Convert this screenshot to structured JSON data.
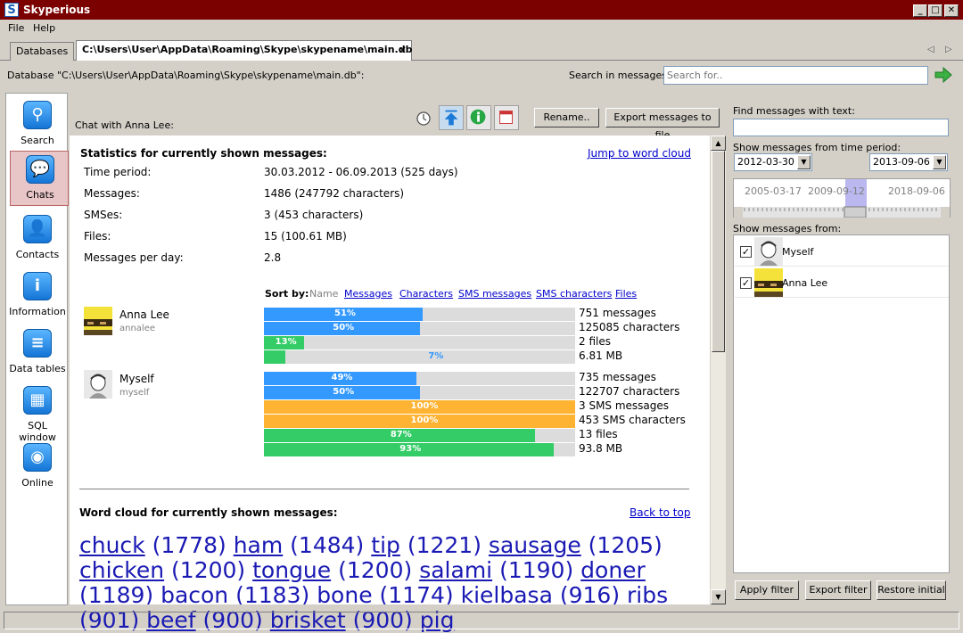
{
  "window": {
    "title": "Skyperious",
    "logo": "S",
    "minimize": "_",
    "maximize": "□",
    "close": "✕"
  },
  "menu": {
    "file": "File",
    "help": "Help"
  },
  "tabs": [
    {
      "label": "Databases"
    },
    {
      "label": "C:\\Users\\User\\AppData\\Roaming\\Skype\\skypename\\main.db",
      "close": "✕"
    }
  ],
  "tab_nav": {
    "prev": "◁",
    "next": "▷"
  },
  "db_path": "Database \"C:\\Users\\User\\AppData\\Roaming\\Skype\\skypename\\main.db\":",
  "search": {
    "label": "Search in messages:",
    "placeholder": "Search for.."
  },
  "nav": [
    {
      "label": "Search",
      "icon": "magnifier-icon"
    },
    {
      "label": "Chats",
      "icon": "chat-bubble-icon"
    },
    {
      "label": "Contacts",
      "icon": "person-icon"
    },
    {
      "label": "Information",
      "icon": "info-icon"
    },
    {
      "label": "Data tables",
      "icon": "database-icon"
    },
    {
      "label": "SQL window",
      "icon": "grid-icon"
    },
    {
      "label": "Online",
      "icon": "signal-icon"
    }
  ],
  "chat": {
    "title": "Chat with Anna Lee:",
    "rename": "Rename..",
    "export": "Export messages to file"
  },
  "stats": {
    "heading": "Statistics for currently shown messages:",
    "jump": "Jump to word cloud",
    "rows": [
      {
        "label": "Time period:",
        "value": "30.03.2012 - 06.09.2013 (525 days)"
      },
      {
        "label": "Messages:",
        "value": "1486 (247792 characters)"
      },
      {
        "label": "SMSes:",
        "value": "3 (453 characters)"
      },
      {
        "label": "Files:",
        "value": "15 (100.61 MB)"
      },
      {
        "label": "Messages per day:",
        "value": "2.8"
      }
    ],
    "sort_label": "Sort by:",
    "sort_options": [
      "Name",
      "Messages",
      "Characters",
      "SMS messages",
      "SMS characters",
      "Files"
    ]
  },
  "participants": [
    {
      "name": "Anna Lee",
      "handle": "annalee",
      "bars": [
        {
          "pct": 51,
          "label": "51%",
          "color": "#3399ff",
          "value": "751 messages"
        },
        {
          "pct": 50,
          "label": "50%",
          "color": "#3399ff",
          "value": "125085 characters"
        },
        {
          "pct": 13,
          "label": "13%",
          "color": "#33cc66",
          "value": "2 files"
        },
        {
          "pct": 7,
          "label": "7%",
          "color": "#33cc66",
          "value": "6.81 MB"
        }
      ]
    },
    {
      "name": "Myself",
      "handle": "myself",
      "bars": [
        {
          "pct": 49,
          "label": "49%",
          "color": "#3399ff",
          "value": "735 messages"
        },
        {
          "pct": 50,
          "label": "50%",
          "color": "#3399ff",
          "value": "122707 characters"
        },
        {
          "pct": 100,
          "label": "100%",
          "color": "#ffb333",
          "value": "3 SMS messages"
        },
        {
          "pct": 100,
          "label": "100%",
          "color": "#ffb333",
          "value": "453 SMS characters"
        },
        {
          "pct": 87,
          "label": "87%",
          "color": "#33cc66",
          "value": "13 files"
        },
        {
          "pct": 93,
          "label": "93%",
          "color": "#33cc66",
          "value": "93.8 MB"
        }
      ]
    }
  ],
  "wordcloud": {
    "heading": "Word cloud for currently shown messages:",
    "back": "Back to top",
    "words": [
      {
        "w": "chuck",
        "n": "(1778)"
      },
      {
        "w": "ham",
        "n": "(1484)"
      },
      {
        "w": "tip",
        "n": "(1221)"
      },
      {
        "w": "sausage",
        "n": "(1205)"
      },
      {
        "w": "chicken",
        "n": "(1200)"
      },
      {
        "w": "tongue",
        "n": "(1200)"
      },
      {
        "w": "salami",
        "n": "(1190)"
      },
      {
        "w": "doner",
        "n": "(1189)"
      },
      {
        "w": "bacon",
        "n": "(1183)"
      },
      {
        "w": "bone",
        "n": "(1174)"
      },
      {
        "w": "kielbasa",
        "n": "(916)"
      },
      {
        "w": "ribs",
        "n": "(901)"
      },
      {
        "w": "beef",
        "n": "(900)"
      },
      {
        "w": "brisket",
        "n": "(900)"
      },
      {
        "w": "pig",
        "n": ""
      }
    ]
  },
  "filter": {
    "find_label": "Find messages with text:",
    "period_label": "Show messages from time period:",
    "date_from": "2012-03-30",
    "date_to": "2013-09-06",
    "timeline_labels": [
      "2005-03-17",
      "2009-09-12",
      "2018-09-06"
    ],
    "from_label": "Show messages from:",
    "people": [
      {
        "name": "Myself",
        "checked": true
      },
      {
        "name": "Anna Lee",
        "checked": true
      }
    ],
    "apply": "Apply filter",
    "export": "Export filter",
    "restore": "Restore initial"
  }
}
